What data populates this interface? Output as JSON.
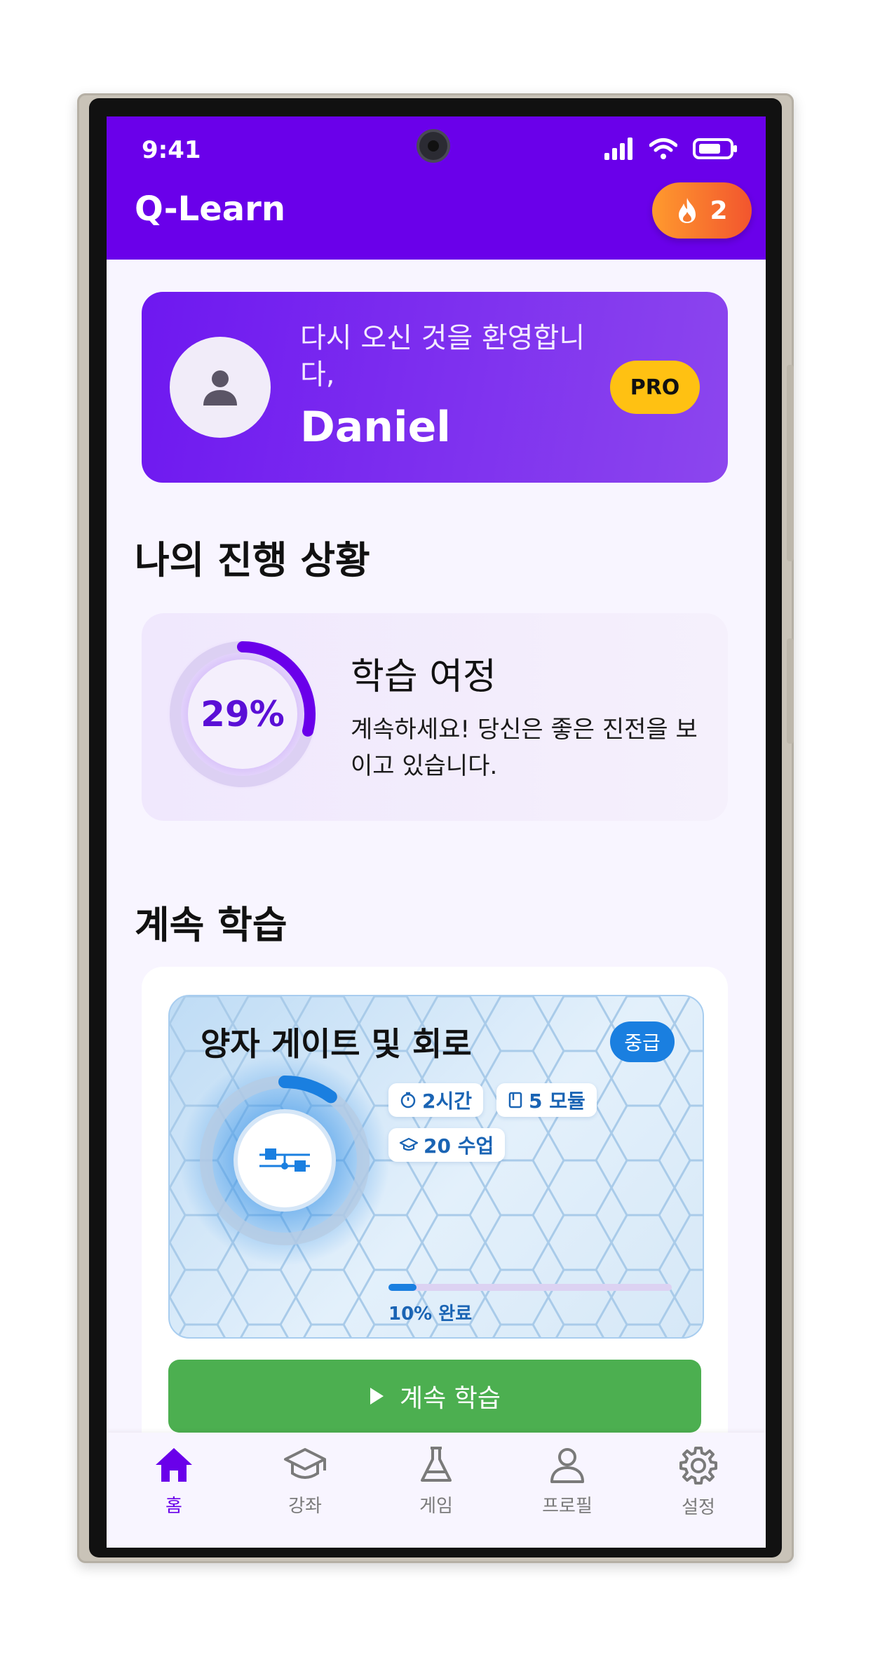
{
  "status_bar": {
    "time": "9:41"
  },
  "header": {
    "app_title": "Q-Learn",
    "streak_count": "2"
  },
  "welcome": {
    "greeting": "다시 오신 것을 환영합니다,",
    "name": "Daniel",
    "badge": "PRO"
  },
  "progress_section": {
    "title": "나의 진행 상황",
    "percent_label": "29%",
    "percent_value": 0.29,
    "journey_title": "학습 여정",
    "journey_desc": "계속하세요! 당신은 좋은 진전을 보이고 있습니다."
  },
  "continue_section": {
    "title": "계속 학습",
    "course": {
      "title": "양자 게이트 및 회로",
      "level": "중급",
      "duration": "2시간",
      "modules": "5 모듈",
      "lessons": "20 수업",
      "progress_label": "10% 완료",
      "progress_value": 0.1
    },
    "button_label": "계속 학습"
  },
  "bottom_nav": [
    {
      "label": "홈",
      "icon": "home-icon",
      "active": true
    },
    {
      "label": "강좌",
      "icon": "graduation-cap-icon",
      "active": false
    },
    {
      "label": "게임",
      "icon": "flask-icon",
      "active": false
    },
    {
      "label": "프로필",
      "icon": "person-icon",
      "active": false
    },
    {
      "label": "설정",
      "icon": "gear-icon",
      "active": false
    }
  ],
  "colors": {
    "primary": "#6a00ea",
    "accent_blue": "#1a7fe0",
    "button_green": "#4caf50",
    "pro_yellow": "#ffc112"
  }
}
